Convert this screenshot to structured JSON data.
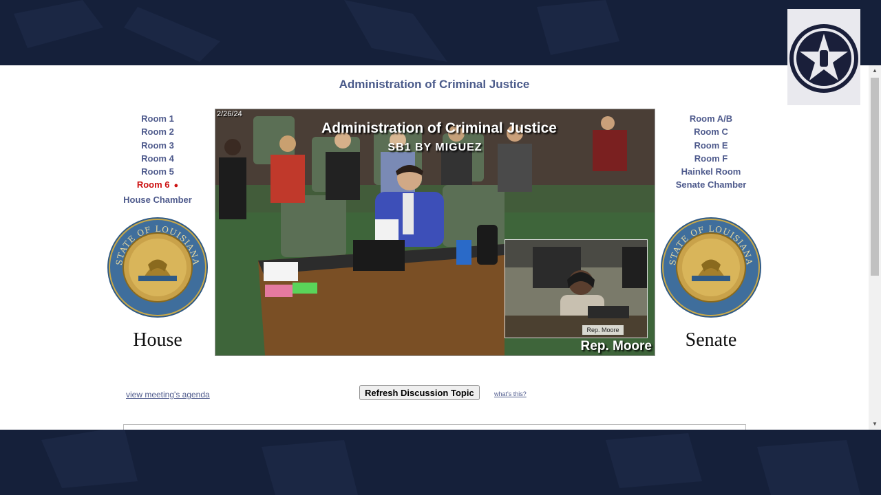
{
  "page": {
    "title": "Administration of Criminal Justice"
  },
  "rooms_house": [
    {
      "label": "Room 1",
      "active": false
    },
    {
      "label": "Room 2",
      "active": false
    },
    {
      "label": "Room 3",
      "active": false
    },
    {
      "label": "Room 4",
      "active": false
    },
    {
      "label": "Room 5",
      "active": false
    },
    {
      "label": "Room 6",
      "active": true
    },
    {
      "label": "House Chamber",
      "active": false
    }
  ],
  "rooms_senate": [
    {
      "label": "Room A/B"
    },
    {
      "label": "Room C"
    },
    {
      "label": "Room E"
    },
    {
      "label": "Room F"
    },
    {
      "label": "Hainkel Room"
    },
    {
      "label": "Senate Chamber"
    }
  ],
  "live_indicator": "●",
  "chambers": {
    "house": "House",
    "senate": "Senate"
  },
  "seal_text": {
    "top": "STATE OF LOUISIANA",
    "bottom": "CONFIDENCE",
    "banner": "UNION JUSTICE"
  },
  "video": {
    "date": "2/26/24",
    "title": "Administration of Criminal Justice",
    "subtitle": "SB1 BY MIGUEZ",
    "speaker": "Rep. Moore",
    "nameplate": "Rep. Moore"
  },
  "controls": {
    "agenda_link": "view meeting's agenda",
    "refresh_button": "Refresh Discussion Topic",
    "whats_this": "what's this?"
  },
  "colors": {
    "link": "#4e5a8c",
    "active": "#cc1111",
    "background": "#15203a"
  }
}
